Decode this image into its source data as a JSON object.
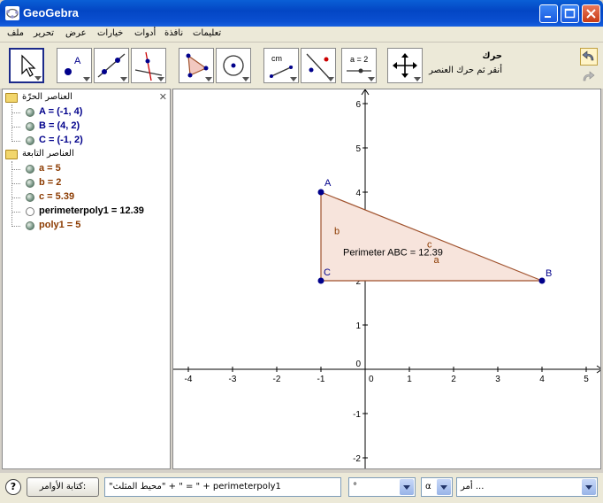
{
  "window": {
    "title": "GeoGebra",
    "minimize_glyph": "minimize-icon",
    "maximize_glyph": "maximize-icon",
    "close_glyph": "close-icon"
  },
  "menu": [
    "ملف",
    "تحرير",
    "عرض",
    "خيارات",
    "أدوات",
    "نافذة",
    "تعليمات"
  ],
  "toolbar": {
    "tools": [
      {
        "name": "move-tool-icon"
      },
      {
        "name": "new-point-tool-icon"
      },
      {
        "name": "line-tool-icon"
      },
      {
        "name": "perpendicular-line-tool-icon"
      },
      {
        "name": "polygon-tool-icon"
      },
      {
        "name": "circle-tool-icon"
      },
      {
        "name": "distance-tool-icon"
      },
      {
        "name": "reflect-tool-icon"
      },
      {
        "name": "slider-tool-icon",
        "text": "a = 2"
      },
      {
        "name": "move-graphics-view-tool-icon"
      }
    ],
    "distance_tool_text": "cm",
    "selected_tool_title": "حرك",
    "selected_tool_help": "أنقر ثم حرك العنصر"
  },
  "algebra": {
    "free_folder": "العناصر الحرّة",
    "dependent_folder": "العناصر التابعة",
    "free_items": [
      "A = (-1, 4)",
      "B = (4, 2)",
      "C = (-1, 2)"
    ],
    "dependent_items": [
      "a = 5",
      "b = 2",
      "c = 5.39",
      "perimeterpoly1 = 12.39",
      "poly1 = 5"
    ]
  },
  "graphics": {
    "x_ticks": [
      "-4",
      "-3",
      "-2",
      "-1",
      "0",
      "1",
      "2",
      "3",
      "4",
      "5"
    ],
    "y_ticks": [
      "6",
      "5",
      "4",
      "3",
      "2",
      "1",
      "0",
      "-1",
      "-2"
    ],
    "point_labels": [
      "A",
      "B",
      "C"
    ],
    "segment_labels": [
      "a",
      "b",
      "c"
    ],
    "perimeter_text": "Perimeter ABC = 12.39",
    "points": [
      {
        "name": "A",
        "x": -1,
        "y": 4
      },
      {
        "name": "B",
        "x": 4,
        "y": 2
      },
      {
        "name": "C",
        "x": -1,
        "y": 2
      }
    ],
    "colors": {
      "polygon_fill": "#f7e4dc",
      "polygon_stroke": "#a0522d",
      "point": "#00008b",
      "segment_label": "#8b3a00"
    }
  },
  "inputbar": {
    "help_glyph": "?",
    "input_button": "كتابة الأوامر:",
    "input_value": "\"محيط المثلث\" + \" = \" + perimeterpoly1",
    "symbol_combo": "°",
    "greek_combo": "α",
    "command_combo": "أمر ..."
  }
}
